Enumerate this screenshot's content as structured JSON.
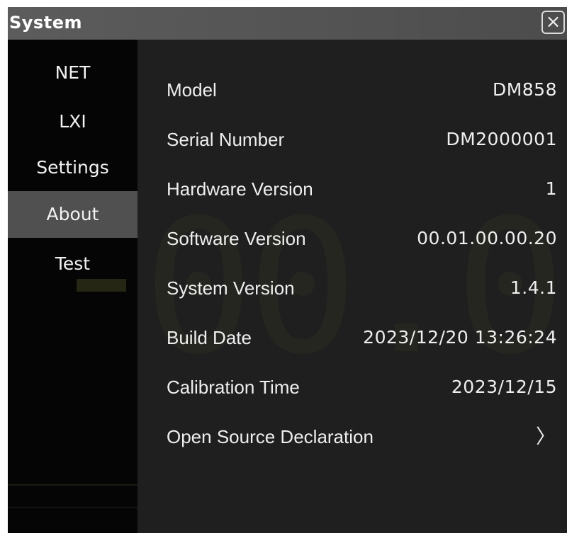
{
  "window": {
    "title": "System",
    "close_icon": "×"
  },
  "sidebar": {
    "items": [
      {
        "label": "NET",
        "active": false
      },
      {
        "label": "LXI",
        "active": false
      },
      {
        "label": "Settings",
        "active": false
      },
      {
        "label": "About",
        "active": true
      },
      {
        "label": "Test",
        "active": false
      }
    ]
  },
  "about": {
    "rows": [
      {
        "label": "Model",
        "value": "DM858"
      },
      {
        "label": "Serial Number",
        "value": "DM2000001"
      },
      {
        "label": "Hardware Version",
        "value": "1"
      },
      {
        "label": "Software Version",
        "value": "00.01.00.00.20"
      },
      {
        "label": "System Version",
        "value": "1.4.1"
      },
      {
        "label": "Build Date",
        "value": "2023/12/20 13:26:24"
      },
      {
        "label": "Calibration Time",
        "value": "2023/12/15"
      }
    ],
    "open_source": {
      "label": "Open Source Declaration",
      "icon": "chevron-right-icon",
      "glyph": "〉"
    }
  },
  "colors": {
    "background": "#1f1f1f",
    "sidebar": "#050505",
    "active_item": "#505050",
    "text": "#eeeeee"
  }
}
